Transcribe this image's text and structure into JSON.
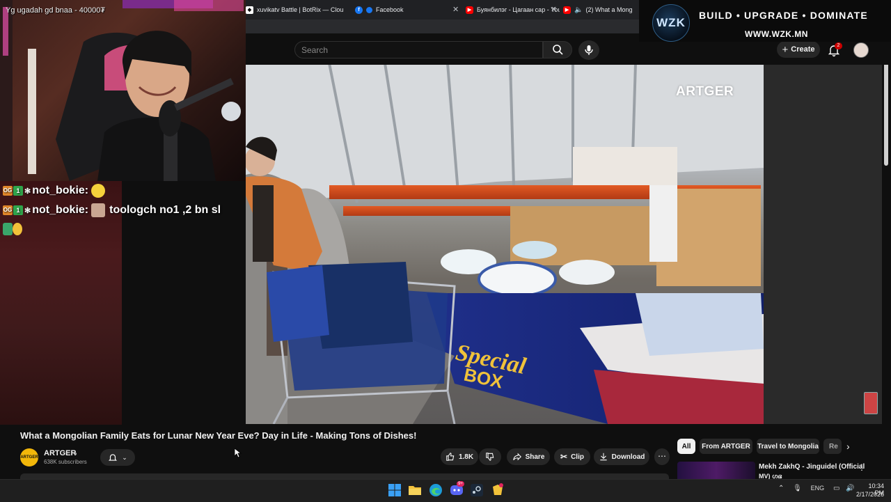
{
  "browser": {
    "tabs": [
      {
        "label": "xuvikatv Battle | BotRix — Cloud S",
        "icon": "botrix-icon"
      },
      {
        "label": "Facebook",
        "icon": "facebook-icon"
      },
      {
        "label": "Буянбилэг - Цагаан сар - YouT",
        "icon": "youtube-icon"
      },
      {
        "label": "(2) What a Mong",
        "icon": "youtube-icon"
      }
    ]
  },
  "youtube": {
    "search": {
      "placeholder": "Search"
    },
    "create_label": "Create",
    "notification_count": "2",
    "video": {
      "watermark": "ARTGER",
      "title": "What a Mongolian Family Eats for Lunar New Year Eve? Day in Life - Making Tons of Dishes!",
      "channel": {
        "name": "ARTGER",
        "subscribers": "638K subscribers",
        "avatar_text": "ARTGER"
      },
      "actions": {
        "likes": "1.8K",
        "share": "Share",
        "clip": "Clip",
        "download": "Download"
      }
    },
    "chips": [
      "All",
      "From ARTGER",
      "Travel to Mongolia",
      "Re"
    ],
    "recommendation": {
      "title": "Mekh ZakhQ - Jinguidel (Official",
      "title_line2": "MV) ഗഭ"
    }
  },
  "overlay": {
    "donation_text": "Yg ugadah gd bnaa - 40000₮",
    "chat": [
      {
        "user": "not_bokie:",
        "message": ""
      },
      {
        "user": "not_bokie:",
        "message": "toologch no1 ,2 bn sl"
      }
    ],
    "badges": {
      "og": "OG",
      "rank": "1"
    },
    "banner": {
      "logo": "WZK",
      "tagline": "BUILD • UPGRADE • DOMINATE",
      "url": "WWW.WZK.MN"
    }
  },
  "taskbar": {
    "apps": [
      "windows-start-icon",
      "file-explorer-icon",
      "edge-browser-icon",
      "discord-icon",
      "steam-icon",
      "game-app-icon"
    ],
    "discord_badge": "9+",
    "language": "ENG",
    "time": "10:34 PM",
    "date": "2/17/2026"
  },
  "colors": {
    "accent_red": "#cc0000",
    "background": "#0f0f0f",
    "chip_bg": "#272727",
    "channel_avatar": "#f2b70a"
  }
}
